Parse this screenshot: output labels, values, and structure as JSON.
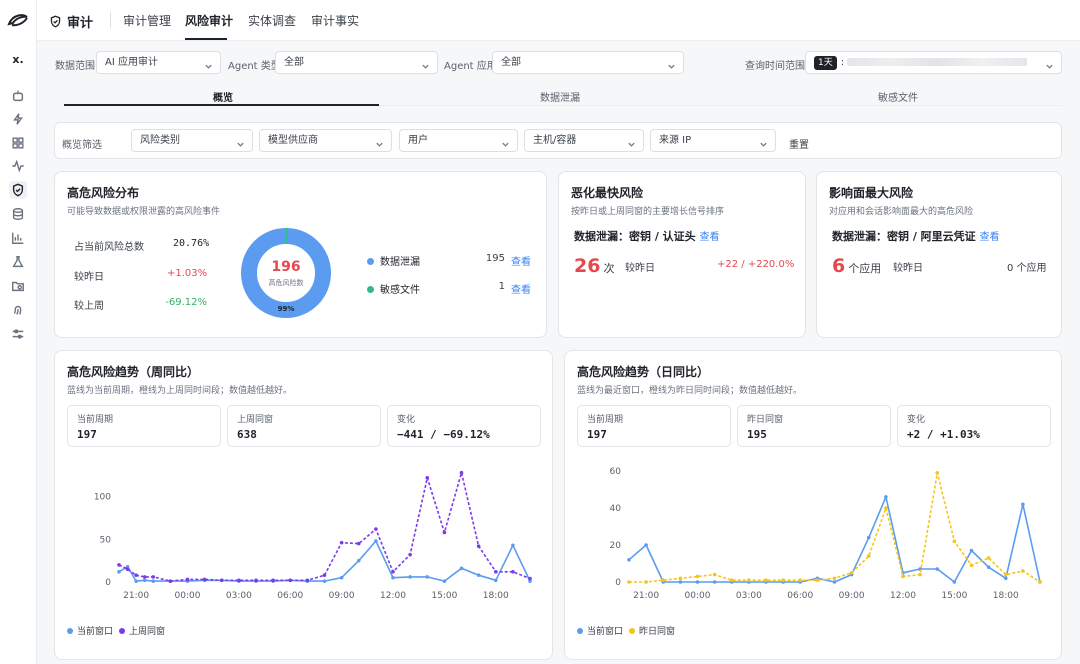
{
  "brand": {
    "title": "审计"
  },
  "nav": {
    "tabs": [
      "审计管理",
      "风险审计",
      "实体调查",
      "审计事实"
    ],
    "active_index": 1
  },
  "sidebar": {
    "workspace_badge": "x."
  },
  "filters": {
    "scope_label": "数据范围",
    "scope_value": "AI 应用审计",
    "agent_type_label": "Agent 类型",
    "agent_type_value": "全部",
    "agent_app_label": "Agent 应用",
    "agent_app_value": "全部",
    "time_label": "查询时间范围",
    "time_badge": "1天",
    "time_sep": ":"
  },
  "subtabs": {
    "items": [
      "概览",
      "数据泄漏",
      "敏感文件"
    ],
    "active_index": 0
  },
  "overview_filter": {
    "label": "概览筛选",
    "selects": [
      "风险类别",
      "模型供应商",
      "用户",
      "主机/容器",
      "来源 IP"
    ],
    "reset": "重置"
  },
  "dist": {
    "title": "高危风险分布",
    "subtitle": "可能导致数据或权限泄露的高风险事件",
    "rows": [
      {
        "label": "占当前风险总数",
        "value": "20.76%",
        "tone": "neutral"
      },
      {
        "label": "较昨日",
        "value": "+1.03%",
        "tone": "up"
      },
      {
        "label": "较上周",
        "value": "-69.12%",
        "tone": "down"
      }
    ],
    "donut": {
      "total": "196",
      "caption": "高危风险数",
      "pct_label": "99%",
      "main_color": "#5b9cf0",
      "minor_color": "#2ebd85"
    },
    "legend": [
      {
        "name": "数据泄漏",
        "count": "195",
        "action": "查看",
        "color": "#5b9cf0"
      },
      {
        "name": "敏感文件",
        "count": "1",
        "action": "查看",
        "color": "#2ebd85"
      }
    ]
  },
  "worsen": {
    "title": "恶化最快风险",
    "subtitle": "按昨日或上周同窗的主要增长信号排序",
    "item": "数据泄漏：密钥 / 认证头",
    "action": "查看",
    "count": "26",
    "unit": "次",
    "compare_label": "较昨日",
    "compare_value": "+22 / +220.0%"
  },
  "impact": {
    "title": "影响面最大风险",
    "subtitle": "对应用和会话影响面最大的高危风险",
    "item": "数据泄漏：密钥 / 阿里云凭证",
    "action": "查看",
    "count": "6",
    "unit": "个应用",
    "compare_label": "较昨日",
    "compare_value": "0 个应用"
  },
  "weekly": {
    "title": "高危风险趋势（周同比）",
    "subtitle": "蓝线为当前周期，橙线为上周同时间段；数值越低越好。",
    "stats": [
      {
        "label": "当前周期",
        "value": "197",
        "tone": "neutral"
      },
      {
        "label": "上周同窗",
        "value": "638",
        "tone": "neutral"
      },
      {
        "label": "变化",
        "value": "−441 / −69.12%",
        "tone": "down"
      }
    ],
    "legend": [
      {
        "name": "当前窗口",
        "color": "#5b9cf0"
      },
      {
        "name": "上周同窗",
        "color": "#7c3aed"
      }
    ]
  },
  "daily": {
    "title": "高危风险趋势（日同比）",
    "subtitle": "蓝线为最近窗口，橙线为昨日同时间段；数值越低越好。",
    "stats": [
      {
        "label": "当前周期",
        "value": "197",
        "tone": "neutral"
      },
      {
        "label": "昨日同窗",
        "value": "195",
        "tone": "neutral"
      },
      {
        "label": "变化",
        "value": "+2 / +1.03%",
        "tone": "up"
      }
    ],
    "legend": [
      {
        "name": "当前窗口",
        "color": "#5b9cf0"
      },
      {
        "name": "昨日同窗",
        "color": "#f5c518"
      }
    ]
  },
  "chart_data": [
    {
      "type": "line",
      "x_ticks": [
        "21:00",
        "00:00",
        "03:00",
        "06:00",
        "09:00",
        "12:00",
        "15:00",
        "18:00"
      ],
      "y_ticks": [
        0,
        50,
        100
      ],
      "ylim": [
        0,
        130
      ],
      "x": [
        20,
        20.5,
        21,
        21.5,
        22,
        23,
        24,
        25,
        26,
        27,
        28,
        29,
        30,
        31,
        32,
        33,
        34,
        35,
        36,
        37,
        38,
        39,
        40,
        41,
        42,
        43,
        44
      ],
      "series": [
        {
          "name": "当前窗口",
          "color": "#5b9cf0",
          "style": "solid",
          "values": [
            12,
            18,
            1,
            2,
            1,
            1,
            1,
            2,
            2,
            1,
            1,
            1,
            2,
            1,
            1,
            5,
            25,
            48,
            5,
            6,
            6,
            1,
            16,
            8,
            2,
            43,
            1
          ]
        },
        {
          "name": "上周同窗",
          "color": "#7c3aed",
          "style": "dashed",
          "values": [
            20,
            15,
            8,
            6,
            6,
            1,
            3,
            3,
            2,
            2,
            2,
            2,
            2,
            2,
            8,
            46,
            45,
            62,
            12,
            32,
            122,
            58,
            128,
            42,
            12,
            12,
            4
          ]
        }
      ]
    },
    {
      "type": "line",
      "x_ticks": [
        "21:00",
        "00:00",
        "03:00",
        "06:00",
        "09:00",
        "12:00",
        "15:00",
        "18:00"
      ],
      "y_ticks": [
        0,
        20,
        40,
        60
      ],
      "ylim": [
        0,
        60
      ],
      "x": [
        20,
        21,
        22,
        23,
        24,
        25,
        26,
        27,
        28,
        29,
        30,
        31,
        32,
        33,
        34,
        35,
        36,
        37,
        38,
        39,
        40,
        41,
        42,
        43,
        44
      ],
      "series": [
        {
          "name": "当前窗口",
          "color": "#5b9cf0",
          "style": "solid",
          "values": [
            12,
            20,
            0,
            0,
            0,
            0,
            0,
            0,
            0,
            0,
            0,
            2,
            0,
            4,
            24,
            46,
            5,
            7,
            7,
            0,
            17,
            8,
            2,
            42,
            0
          ]
        },
        {
          "name": "昨日同窗",
          "color": "#f5c518",
          "style": "dashed",
          "values": [
            0,
            0,
            1,
            2,
            3,
            4,
            1,
            1,
            1,
            1,
            1,
            1,
            2,
            5,
            14,
            40,
            3,
            4,
            59,
            22,
            9,
            13,
            4,
            6,
            0
          ]
        }
      ]
    }
  ]
}
